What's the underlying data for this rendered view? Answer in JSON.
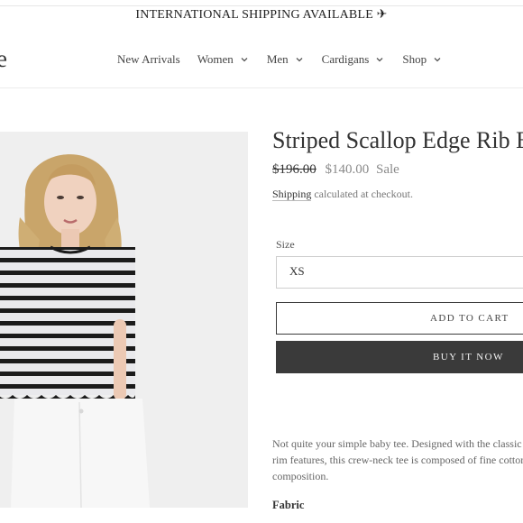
{
  "announcement": {
    "text": "INTERNATIONAL SHIPPING AVAILABLE ✈"
  },
  "logo": {
    "text": "e"
  },
  "nav": {
    "items": [
      {
        "label": "New Arrivals",
        "has_dropdown": false
      },
      {
        "label": "Women",
        "has_dropdown": true
      },
      {
        "label": "Men",
        "has_dropdown": true
      },
      {
        "label": "Cardigans",
        "has_dropdown": true
      },
      {
        "label": "Shop",
        "has_dropdown": true
      }
    ]
  },
  "product": {
    "title": "Striped Scallop Edge Rib B",
    "price_original": "$196.00",
    "price_sale": "$140.00",
    "sale_label": "Sale",
    "shipping_link": "Shipping",
    "shipping_text": " calculated at checkout.",
    "size_label": "Size",
    "size_value": "XS",
    "add_to_cart": "ADD TO CART",
    "buy_now": "BUY IT NOW",
    "description_lines": [
      "Not quite your simple baby tee. Designed with the classic",
      "rim features, this crew-neck tee is composed of fine cotton",
      "composition."
    ],
    "fabric_heading": "Fabric"
  },
  "colors": {
    "accent": "#3a3a3a",
    "muted": "#8a8a8a",
    "border": "#cfcfcf"
  }
}
